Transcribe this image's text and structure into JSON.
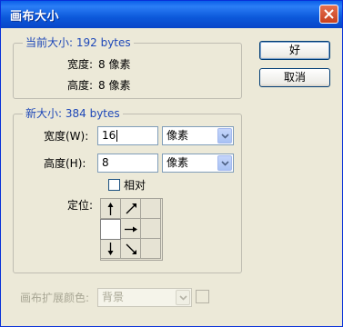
{
  "window": {
    "title": "画布大小"
  },
  "current_size": {
    "legend": "当前大小: 192 bytes",
    "width_label": "宽度:",
    "width_value": "8 像素",
    "height_label": "高度:",
    "height_value": "8 像素"
  },
  "new_size": {
    "legend": "新大小: 384 bytes",
    "width_label": "宽度(W):",
    "width_value": "16",
    "width_unit": "像素",
    "height_label": "高度(H):",
    "height_value": "8",
    "height_unit": "像素",
    "relative_label": "相对",
    "relative_checked": false,
    "anchor_label": "定位:"
  },
  "extension": {
    "label": "画布扩展颜色:",
    "value": "背景"
  },
  "buttons": {
    "ok": "好",
    "cancel": "取消"
  },
  "icons": {
    "close": "close-icon",
    "dropdown": "chevron-down-icon",
    "arrows": [
      "arrow-up-icon",
      "arrow-up-right-icon",
      "arrow-right-icon",
      "arrow-down-icon",
      "arrow-down-right-icon"
    ]
  },
  "colors": {
    "titlebar": "#0A5FE8",
    "legend_text": "#1E48B8",
    "dialog_bg": "#ECE9D8",
    "close_button": "#D0502A"
  }
}
